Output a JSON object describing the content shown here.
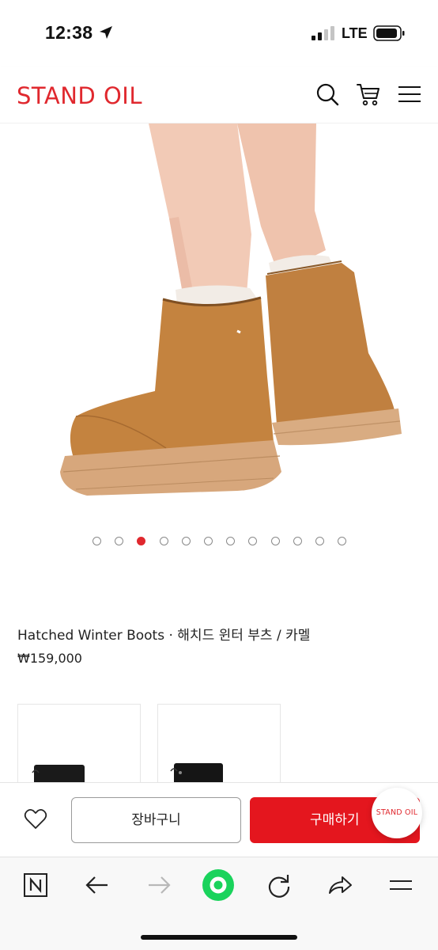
{
  "status_bar": {
    "time": "12:38",
    "network": "LTE"
  },
  "header": {
    "logo": "STAND OIL",
    "icons": [
      "search-icon",
      "cart-icon",
      "menu-icon"
    ],
    "brand_color": "#e0282e"
  },
  "gallery": {
    "image": "camel-winter-boots-photo",
    "total": 12,
    "active_index": 2,
    "active_color": "#e0282e"
  },
  "product": {
    "name": "Hatched Winter Boots · 해치드 윈터 부츠 / 카멜",
    "price": "₩159,000"
  },
  "action_bar": {
    "wishlist_icon": "heart-icon",
    "cart_label": "장바구니",
    "buy_label": "구매하기",
    "badge_label": "STAND OIL",
    "buy_color": "#e4161e"
  },
  "browser_toolbar": {
    "icons": [
      "naver-home-icon",
      "back-arrow-icon",
      "forward-arrow-icon",
      "green-dot-icon",
      "refresh-icon",
      "share-icon",
      "menu-icon"
    ]
  }
}
